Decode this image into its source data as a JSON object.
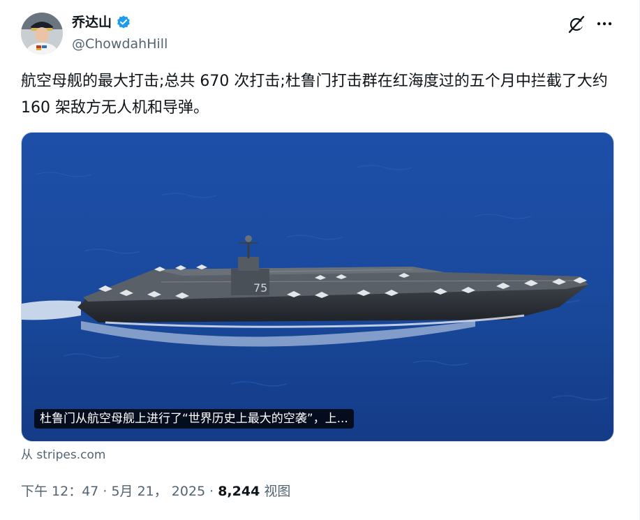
{
  "author": {
    "display_name": "乔达山",
    "handle": "@ChowdahHill",
    "verified": true
  },
  "icons": {
    "avatar": "avatar",
    "verified": "verified-badge-icon",
    "grok": "grok-icon",
    "more": "more-options-icon"
  },
  "tweet": {
    "text": "航空母舰的最大打击;总共 670 次打击;杜鲁门打击群在红海度过的五个月中拦截了大约 160 架敌方无人机和导弹。"
  },
  "card": {
    "caption": "杜鲁门从航空母舰上进行了“世界历史上最大的空袭”，上...",
    "source": "从 stripes.com"
  },
  "meta": {
    "time": "下午 12：47",
    "date": "5月 21， 2025",
    "views_count": "8,244",
    "views_label": "视图"
  },
  "colors": {
    "accent": "#1d9bf0",
    "secondary_text": "#536471",
    "primary_text": "#0f1419"
  }
}
